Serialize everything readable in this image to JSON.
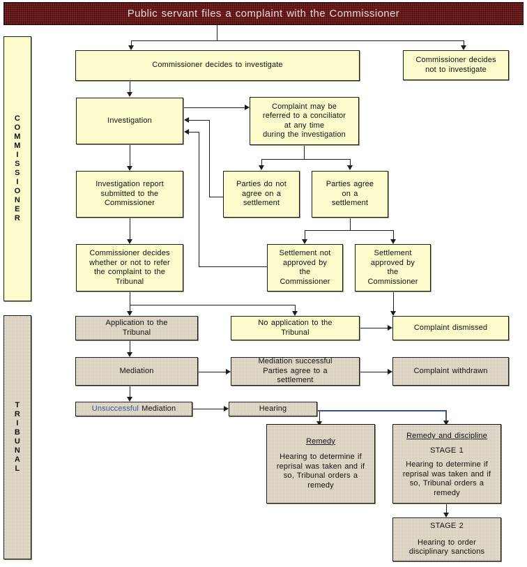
{
  "banner": {
    "title": "Public servant files a complaint with the Commissioner",
    "color": "#7b2020",
    "text_color": "#ead8d8"
  },
  "rails": [
    {
      "id": "commissioner",
      "label": "COMMISSIONER",
      "letters": [
        "C",
        "O",
        "M",
        "M",
        "I",
        "S",
        "S",
        "I",
        "O",
        "N",
        "E",
        "R"
      ],
      "fill": "#fbfbcc"
    },
    {
      "id": "tribunal",
      "label": "TRIBUNAL",
      "letters": [
        "T",
        "R",
        "I",
        "B",
        "U",
        "N",
        "A",
        "L"
      ],
      "fill": "#cbbfa6"
    }
  ],
  "palette": {
    "commissioner_fill": "#fbfbcc",
    "tribunal_fill": "#cbbfa6",
    "banner_fill": "#7b2020",
    "connector": "#1c1c1c",
    "highlight_blue": "#3a5a9b"
  },
  "chart_data": {
    "type": "diagram",
    "title": "Public servant files a complaint with the Commissioner",
    "swimlanes": [
      "COMMISSIONER",
      "TRIBUNAL"
    ],
    "nodes": [
      {
        "id": "n1",
        "lane": "COMMISSIONER",
        "text": "Commissioner decides to investigate"
      },
      {
        "id": "n2",
        "lane": "COMMISSIONER",
        "text": "Commissioner decides not to investigate"
      },
      {
        "id": "n3",
        "lane": "COMMISSIONER",
        "text": "Investigation"
      },
      {
        "id": "n4",
        "lane": "COMMISSIONER",
        "text": "Complaint may be referred to a conciliator at any time during the investigation"
      },
      {
        "id": "n5",
        "lane": "COMMISSIONER",
        "text": "Investigation report submitted to the Commissioner"
      },
      {
        "id": "n6",
        "lane": "COMMISSIONER",
        "text": "Parties do not agree on a settlement"
      },
      {
        "id": "n7",
        "lane": "COMMISSIONER",
        "text": "Parties agree on a settlement"
      },
      {
        "id": "n8",
        "lane": "COMMISSIONER",
        "text": "Commissioner decides whether or not to refer the complaint to the Tribunal"
      },
      {
        "id": "n9",
        "lane": "COMMISSIONER",
        "text": "Settlement not approved by the Commissioner"
      },
      {
        "id": "n10",
        "lane": "COMMISSIONER",
        "text": "Settlement approved by the Commissioner"
      },
      {
        "id": "n11",
        "lane": "TRIBUNAL",
        "text": "Application to the Tribunal"
      },
      {
        "id": "n12",
        "lane": "COMMISSIONER",
        "text": "No application to the Tribunal"
      },
      {
        "id": "n13",
        "lane": "COMMISSIONER",
        "text": "Complaint dismissed"
      },
      {
        "id": "n14",
        "lane": "TRIBUNAL",
        "text": "Mediation"
      },
      {
        "id": "n15",
        "lane": "TRIBUNAL",
        "text": "Mediation successful Parties agree to a settlement"
      },
      {
        "id": "n16",
        "lane": "TRIBUNAL",
        "text": "Complaint withdrawn"
      },
      {
        "id": "n17",
        "lane": "TRIBUNAL",
        "text": "Unsuccessful Mediation"
      },
      {
        "id": "n18",
        "lane": "TRIBUNAL",
        "text": "Hearing"
      },
      {
        "id": "n19",
        "lane": "TRIBUNAL",
        "text": "Remedy — Hearing to determine if reprisal was taken and if so, Tribunal orders a remedy"
      },
      {
        "id": "n20",
        "lane": "TRIBUNAL",
        "text": "Remedy and discipline STAGE 1 — Hearing to determine if reprisal was taken and if so, Tribunal orders a remedy"
      },
      {
        "id": "n21",
        "lane": "TRIBUNAL",
        "text": "STAGE 2 — Hearing to order disciplinary sanctions"
      }
    ],
    "edges": [
      {
        "from": "banner",
        "to": "n1"
      },
      {
        "from": "banner",
        "to": "n2"
      },
      {
        "from": "n1",
        "to": "n3"
      },
      {
        "from": "n3",
        "to": "n4"
      },
      {
        "from": "n3",
        "to": "n5"
      },
      {
        "from": "n4",
        "to": "n6"
      },
      {
        "from": "n4",
        "to": "n7"
      },
      {
        "from": "n6",
        "to": "n3"
      },
      {
        "from": "n9",
        "to": "n3"
      },
      {
        "from": "n5",
        "to": "n8"
      },
      {
        "from": "n7",
        "to": "n9"
      },
      {
        "from": "n7",
        "to": "n10"
      },
      {
        "from": "n8",
        "to": "n11"
      },
      {
        "from": "n8",
        "to": "n12"
      },
      {
        "from": "n12",
        "to": "n13"
      },
      {
        "from": "n10",
        "to": "n13"
      },
      {
        "from": "n11",
        "to": "n14"
      },
      {
        "from": "n14",
        "to": "n15"
      },
      {
        "from": "n14",
        "to": "n17"
      },
      {
        "from": "n15",
        "to": "n16"
      },
      {
        "from": "n17",
        "to": "n18"
      },
      {
        "from": "n18",
        "to": "n19"
      },
      {
        "from": "n18",
        "to": "n20",
        "style": "blue"
      },
      {
        "from": "n20",
        "to": "n21"
      }
    ]
  },
  "nodes": {
    "decides_investigate": {
      "line1": "Commissioner decides to investigate"
    },
    "decides_not_investigate": {
      "line1": "Commissioner decides",
      "line2": "not to investigate"
    },
    "investigation": {
      "line1": "Investigation"
    },
    "conciliator": {
      "line1": "Complaint may be",
      "line2": "referred to a conciliator",
      "line3": "at any time",
      "line4": "during the investigation"
    },
    "investigation_report": {
      "line1": "Investigation  report",
      "line2": "submitted  to the",
      "line3": "Commissioner"
    },
    "parties_not_agree": {
      "line1": "Parties do not",
      "line2": "agree on a",
      "line3": "settlement"
    },
    "parties_agree": {
      "line1": "Parties agree",
      "line2": "on a",
      "line3": "settlement"
    },
    "commissioner_refer": {
      "line1": "Commissioner decides",
      "line2": "whether or not to refer",
      "line3": "the complaint to the",
      "line4": "Tribunal"
    },
    "settlement_not_approved": {
      "line1": "Settlement  not",
      "line2": "approved  by",
      "line3": "the",
      "line4": "Commissioner"
    },
    "settlement_approved": {
      "line1": "Settlement",
      "line2": "approved by",
      "line3": "the",
      "line4": "Commissioner"
    },
    "application_tribunal": {
      "line1": "Application to the",
      "line2": "Tribunal"
    },
    "no_application_tribunal": {
      "line1": "No application to the",
      "line2": "Tribunal"
    },
    "complaint_dismissed": {
      "line1": "Complaint dismissed"
    },
    "mediation": {
      "line1": "Mediation"
    },
    "mediation_successful": {
      "line1": "Mediation successful",
      "line2": "Parties agree to a",
      "line3": "settlement"
    },
    "complaint_withdrawn": {
      "line1": "Complaint  withdrawn"
    },
    "unsuccessful_mediation": {
      "word_blue": "Unsuccessful",
      "word_rest": " Mediation"
    },
    "hearing": {
      "line1": "Hearing"
    },
    "remedy": {
      "heading": "Remedy",
      "line1": "Hearing to determine if",
      "line2": "reprisal was  taken  and if",
      "line3": "so, Tribunal orders a",
      "line4": "remedy"
    },
    "remedy_discipline": {
      "heading": "Remedy  and discipline",
      "stage": "STAGE  1",
      "line1": "Hearing to determine if",
      "line2": "reprisal was  taken  and if",
      "line3": "so, Tribunal orders a",
      "line4": "remedy"
    },
    "stage2": {
      "stage": "STAGE  2",
      "line1": "Hearing to order",
      "line2": "disciplinary sanctions"
    }
  }
}
